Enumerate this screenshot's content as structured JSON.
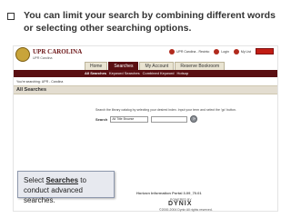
{
  "slide": {
    "bullet_text": "You can limit your search by combining different words or selecting other searching options."
  },
  "app": {
    "logo_text": "UPR CAROLINA",
    "logo_subtext": "UPR Carolina",
    "util_links": [
      "UPR Carolina - Recinto",
      "Login",
      "My List"
    ],
    "main_tabs": [
      {
        "label": "Home",
        "active": false
      },
      {
        "label": "Searches",
        "active": true
      },
      {
        "label": "My Account",
        "active": false
      },
      {
        "label": "Reserve Bookroom",
        "active": false
      }
    ],
    "sub_nav": [
      {
        "label": "All Searches",
        "active": true
      },
      {
        "label": "Keyword Searches",
        "active": false
      },
      {
        "label": "Combined Keyword",
        "active": false
      },
      {
        "label": "Hotsop",
        "active": false
      }
    ],
    "you_are_searching": "You're searching: UPR - Carolina",
    "section_title": "All Searches",
    "instructions": "Search the library catalog by selecting your desired index. Input your term and select the 'go' button.",
    "search": {
      "label": "Search",
      "selected_option": "All Title Browse",
      "input_value": "",
      "go_glyph": "»"
    },
    "footer": {
      "portal_version": "Horizon Information Portal 3.09_70.01",
      "powered_by": "POWERED BY",
      "dynix_logo": "DYNIX",
      "copyright": "©2000-2004 Dynix All rights reserved."
    }
  },
  "callout": {
    "prefix": "Select ",
    "emphasis": "Searches",
    "suffix": "  to conduct advanced searches."
  },
  "colors": {
    "brand_maroon": "#5a0f12",
    "tab_background": "#e9e4d2",
    "section_bar": "#e3ddd0",
    "callout_background": "#e7e9ef",
    "util_red": "#c21d14"
  },
  "icons": {
    "bullet": "hollow-square",
    "go_button": "go-arrow-icon",
    "util_icon": "red-dot-icon",
    "seal": "university-seal-icon"
  }
}
